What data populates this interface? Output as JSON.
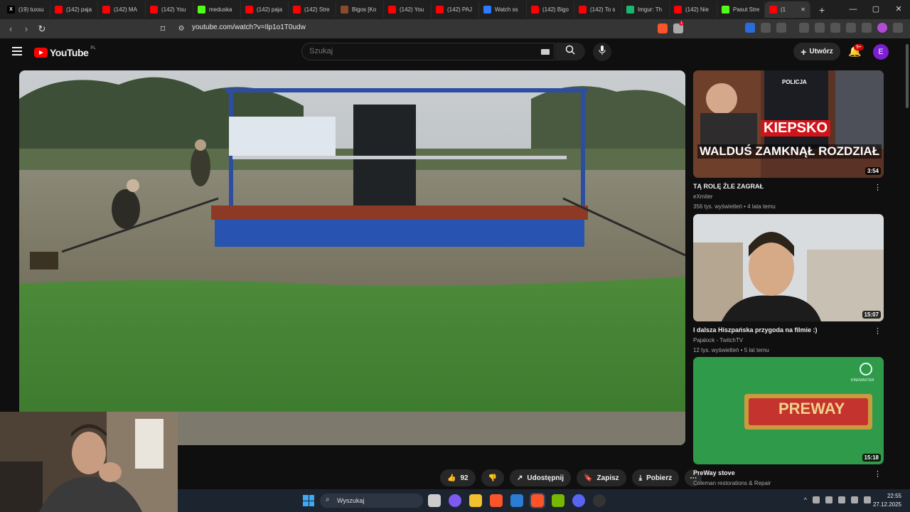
{
  "browser": {
    "tabs": [
      {
        "label": "(19) tuxsu",
        "icon": "x-icon",
        "color": "#000000"
      },
      {
        "label": "(142) paja",
        "icon": "youtube-icon",
        "color": "#ff0000"
      },
      {
        "label": "(142) MA",
        "icon": "youtube-icon",
        "color": "#ff0000"
      },
      {
        "label": "(142) You",
        "icon": "youtube-icon",
        "color": "#ff0000"
      },
      {
        "label": "meduska",
        "icon": "kick-icon",
        "color": "#53fc18"
      },
      {
        "label": "(142) paja",
        "icon": "youtube-icon",
        "color": "#ff0000"
      },
      {
        "label": "(142) Stre",
        "icon": "youtube-icon",
        "color": "#ff0000"
      },
      {
        "label": "Bigos [Ko",
        "icon": "page-icon",
        "color": "#8a4b2d"
      },
      {
        "label": "(142) You",
        "icon": "youtube-icon",
        "color": "#ff0000"
      },
      {
        "label": "(142) PAJ",
        "icon": "youtube-icon",
        "color": "#ff0000"
      },
      {
        "label": "Watch ss",
        "icon": "watch-icon",
        "color": "#2a7bff"
      },
      {
        "label": "(142) Bigo",
        "icon": "youtube-icon",
        "color": "#ff0000"
      },
      {
        "label": "(142) To s",
        "icon": "youtube-icon",
        "color": "#ff0000"
      },
      {
        "label": "Imgur: Th",
        "icon": "imgur-icon",
        "color": "#1bb76e"
      },
      {
        "label": "(142) Nie",
        "icon": "youtube-icon",
        "color": "#ff0000"
      },
      {
        "label": "Pasut Stre",
        "icon": "kick-icon",
        "color": "#53fc18"
      },
      {
        "label": "(1",
        "icon": "youtube-icon",
        "color": "#ff0000",
        "active": true
      }
    ],
    "new_tab": "+",
    "url": "youtube.com/watch?v=Ilp1o1T0udw",
    "brave_badge": "1"
  },
  "youtube": {
    "logo_text": "YouTube",
    "country": "PL",
    "search_placeholder": "Szukaj",
    "create_label": "Utwórz",
    "notif_count": "9+",
    "avatar_letter": "E"
  },
  "actions": {
    "likes": "92",
    "share": "Udostępnij",
    "save": "Zapisz",
    "download": "Pobierz"
  },
  "recommendations": [
    {
      "title": "TĄ ROLĘ ŹLE ZAGRAŁ",
      "channel": "eXmiter",
      "meta": "356 tys. wyświetleń • 4 lata temu",
      "duration": "3:54",
      "thumb_text_1": "KIEPSKO",
      "thumb_text_2": "WALDUŚ ZAMKNĄŁ ROZDZIAŁ",
      "thumb_text_3": "POLICJA"
    },
    {
      "title": "I dalsza Hiszpańska przygoda na filmie :)",
      "channel": "Pajalock - TwitchTV",
      "meta": "12 tys. wyświetleń • 5 lat temu",
      "duration": "15:07"
    },
    {
      "title": "PreWay stove",
      "channel": "Coleman restorations & Repair",
      "meta": "",
      "duration": "15:18",
      "thumb_text_1": "PREWAY",
      "thumb_text_2": "KINEMASTER"
    }
  ],
  "taskbar": {
    "search_placeholder": "Wyszukaj",
    "time": "22:55",
    "date": "27.12.2025"
  }
}
